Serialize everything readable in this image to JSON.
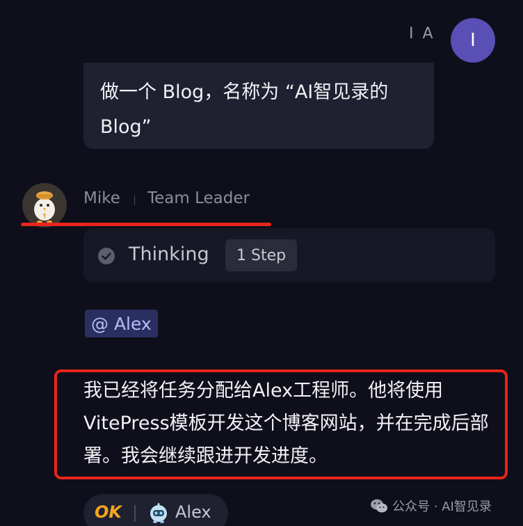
{
  "user": {
    "name": "I A",
    "avatar_initial": "I",
    "avatar_color": "#5a4fb4",
    "message": "做一个 Blog，名称为 “AI智见录的Blog”"
  },
  "agent": {
    "name": "Mike",
    "role": "Team Leader",
    "avatar_icon": "chick-avatar-icon",
    "thinking": {
      "label": "Thinking",
      "steps_badge": "1 Step",
      "status_icon": "check-circle-icon"
    },
    "mention": "@ Alex",
    "message": "我已经将任务分配给Alex工程师。他将使用VitePress模板开发这个博客网站，并在完成后部署。我会继续跟进开发进度。"
  },
  "reaction": {
    "ok_label": "OK",
    "ok_color": "#f3a51e",
    "assignee_icon": "robot-avatar-icon",
    "assignee_name": "Alex"
  },
  "watermark": {
    "icon": "wechat-icon",
    "text": "公众号 · AI智见录"
  },
  "annotation_color": "#e8251c"
}
